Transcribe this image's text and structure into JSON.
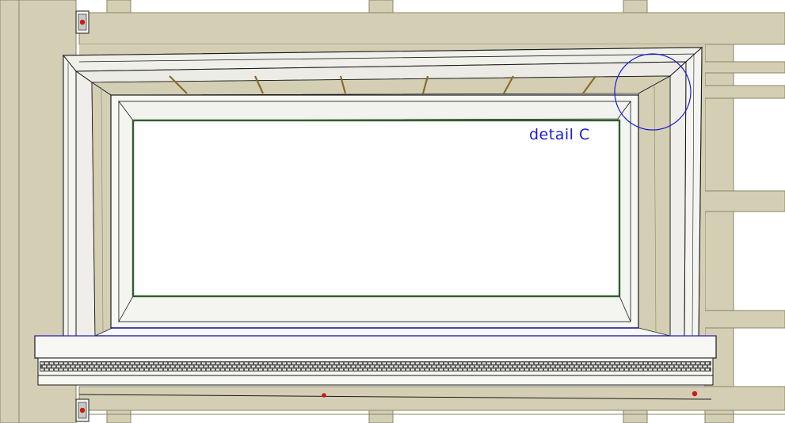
{
  "colors": {
    "background": "#ffffff",
    "framing_wood": "#d4cfb4",
    "framing_edge": "#8a8466",
    "trim_white": "#f7f7f4",
    "trim_shade": "#e4e4df",
    "outline": "#1a1a1a",
    "glass_outline": "#2e5f2e",
    "callout_blue": "#1a1ad6",
    "fastener_red": "#d01818",
    "vent_dark": "#4a4a4a"
  },
  "callout": {
    "label": "detail  C"
  },
  "icons": {
    "callout_circle": "detail-callout-circle-icon",
    "fastener": "fastener-marker-icon",
    "bracket": "bracket-clip-icon"
  }
}
